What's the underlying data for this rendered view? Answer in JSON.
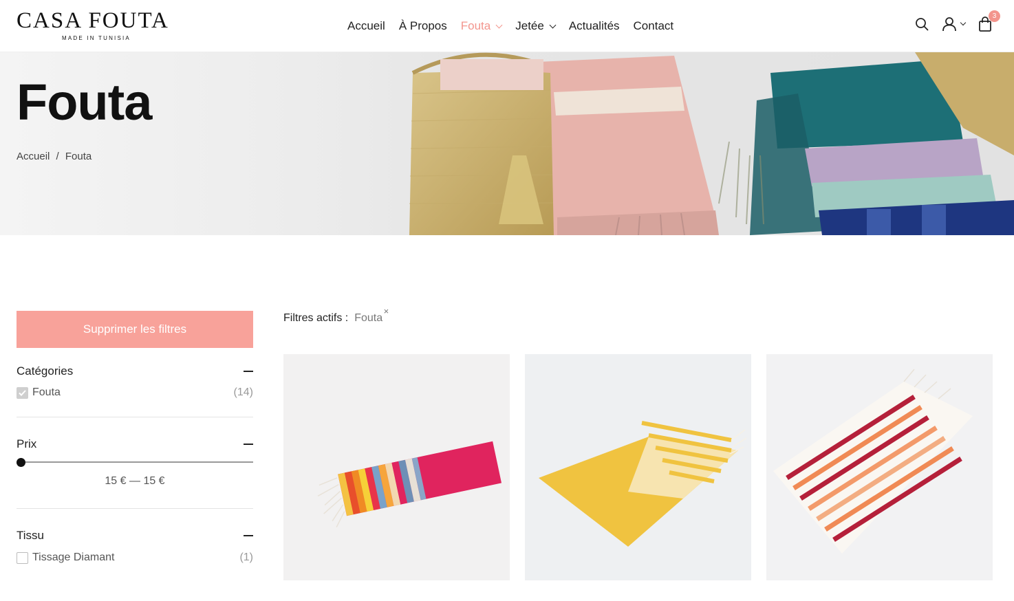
{
  "header": {
    "logo_main": "CASA FOUTA",
    "logo_sub": "MADE IN TUNISIA",
    "nav": [
      {
        "label": "Accueil",
        "active": false,
        "dropdown": false
      },
      {
        "label": "À Propos",
        "active": false,
        "dropdown": false
      },
      {
        "label": "Fouta",
        "active": true,
        "dropdown": true
      },
      {
        "label": "Jetée",
        "active": false,
        "dropdown": true
      },
      {
        "label": "Actualités",
        "active": false,
        "dropdown": false
      },
      {
        "label": "Contact",
        "active": false,
        "dropdown": false
      }
    ],
    "icons": [
      "search-icon",
      "user-icon",
      "cart-icon"
    ],
    "cart_count": "3",
    "accent_color": "#f3958d"
  },
  "hero": {
    "title": "Fouta",
    "breadcrumb_home": "Accueil",
    "breadcrumb_sep": "/",
    "breadcrumb_current": "Fouta"
  },
  "sidebar": {
    "clear_filters": "Supprimer les filtres",
    "clear_color": "#f8a29a",
    "categories": {
      "title": "Catégories",
      "items": [
        {
          "label": "Fouta",
          "count": "(14)",
          "checked": true
        }
      ]
    },
    "price": {
      "title": "Prix",
      "range_text": "15 € — 15 €"
    },
    "fabric": {
      "title": "Tissu",
      "items": [
        {
          "label": "Tissage Diamant",
          "count": "(1)",
          "checked": false
        }
      ]
    }
  },
  "main": {
    "active_filters_label": "Filtres actifs :",
    "active_filter_chip": "Fouta",
    "active_filter_remove": "×",
    "products": [
      {
        "image": "rainbow-striped-fouta"
      },
      {
        "image": "yellow-striped-fouta"
      },
      {
        "image": "red-orange-striped-fouta"
      }
    ]
  }
}
